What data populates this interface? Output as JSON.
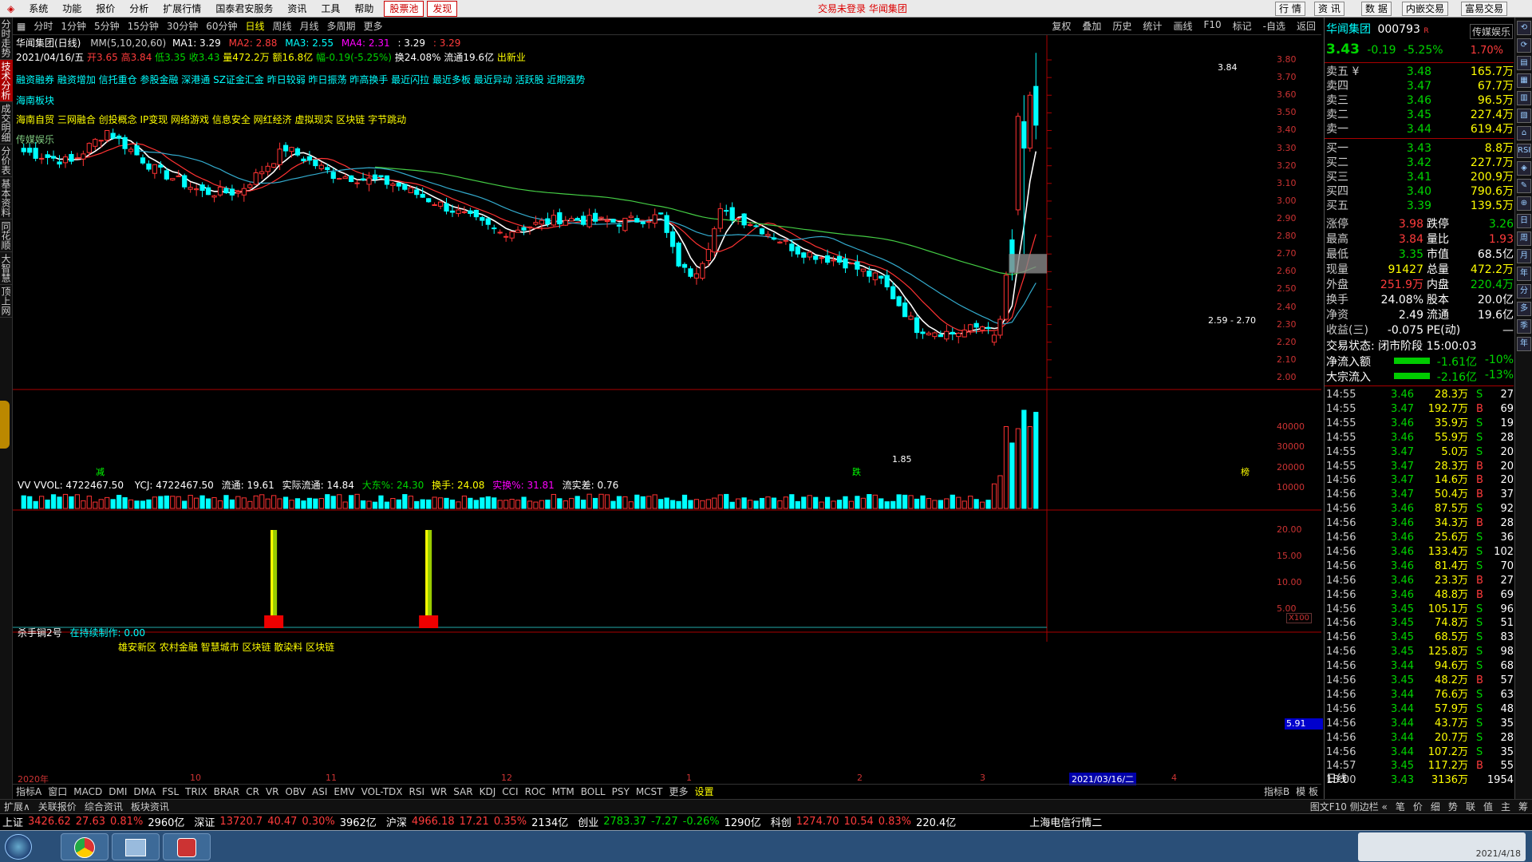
{
  "menubar": {
    "items": [
      "系统",
      "功能",
      "报价",
      "分析",
      "扩展行情",
      "国泰君安服务",
      "资讯",
      "工具",
      "帮助"
    ],
    "hot1": "股票池",
    "hot2": "发现",
    "center_text": "交易未登录  华闻集团",
    "right_buttons": [
      "行 情",
      "资 讯",
      "数 据",
      "内嵌交易",
      "富易交易"
    ]
  },
  "leftbar": [
    "分时走势",
    "技术分析",
    "成交明细",
    "分价表",
    "基本资料",
    "同花顺",
    "大智慧",
    "顶上网"
  ],
  "periodbar": {
    "periods": [
      "分时",
      "1分钟",
      "5分钟",
      "15分钟",
      "30分钟",
      "60分钟",
      "日线",
      "周线",
      "月线",
      "多周期",
      "更多"
    ],
    "active": "日线",
    "right": [
      "复权",
      "叠加",
      "历史",
      "统计",
      "画线",
      "F10",
      "标记",
      "-自选",
      "返回"
    ]
  },
  "chartinfo": {
    "title": "华闻集团(日线)",
    "ma_label": "MM(5,10,20,60)",
    "ma1": "MA1: 3.29",
    "ma2": "MA2: 2.88",
    "ma3": "MA3: 2.55",
    "ma4": "MA4: 2.31",
    "ma5": ": 3.29",
    "ma6": ": 3.29",
    "date": "2021/04/16/五",
    "open": "开3.65",
    "high": "高3.84",
    "low": "低3.35",
    "close": "收3.43",
    "vol": "量472.2万",
    "amount": "额16.8亿",
    "change": "幅-0.19(-5.25%)",
    "turnover": "换24.08%",
    "float": "流通19.6亿",
    "note": "出新业"
  },
  "tags": {
    "line1": "融资融券 融资增加 信托重仓 参股金融 深港通 SZ证金汇金 昨日较弱 昨日振荡 昨高换手 最近闪拉 最近多板 最近异动 活跃股 近期强势",
    "line2": "海南板块",
    "line3": "海南自贸 三网融合 创投概念 IP变现 网络游戏 信息安全 网红经济 虚拟现实 区块链 字节跳动",
    "line4": "传媒娱乐"
  },
  "chart_annotations": {
    "high_label": "3.84",
    "low_label": "1.85",
    "box_label": "2.59 - 2.70",
    "marker_1": "减",
    "marker_2": "跌",
    "marker_3": "榜"
  },
  "price_axis": [
    "3.80",
    "3.70",
    "3.60",
    "3.50",
    "3.40",
    "3.30",
    "3.20",
    "3.10",
    "3.00",
    "2.90",
    "2.80",
    "2.70",
    "2.60",
    "2.50",
    "2.40",
    "2.30",
    "2.20",
    "2.10",
    "2.00"
  ],
  "volume_panel": {
    "header": "VV VVOL: 4722467.50",
    "ycj": "YCJ: 4722467.50",
    "liutong": "流通: 19.61",
    "shiji": "实际流通: 14.84",
    "dadong": "大东%: 24.30",
    "huanshou": "换手: 24.08",
    "shihuan": "实换%: 31.81",
    "liushi": "流实差: 0.76",
    "axis": [
      "40000",
      "30000",
      "20000",
      "10000"
    ],
    "unit": "X100"
  },
  "indicator_panel": {
    "name": "杀手锏2号",
    "status": "在持续制作: 0.00",
    "sectors": "雄安新区 农村金融 智慧城市 区块链 散染料 区块链",
    "axis": [
      "20.00",
      "15.00",
      "10.00",
      "5.00"
    ],
    "current": "5.91"
  },
  "time_axis": [
    "2020年",
    "10",
    "11",
    "12",
    "1",
    "2",
    "3",
    "4"
  ],
  "time_highlight": "2021/03/16/二",
  "indicator_tabs": [
    "指标A",
    "窗口",
    "MACD",
    "DMI",
    "DMA",
    "FSL",
    "TRIX",
    "BRAR",
    "CR",
    "VR",
    "OBV",
    "ASI",
    "EMV",
    "VOL-TDX",
    "RSI",
    "WR",
    "SAR",
    "KDJ",
    "CCI",
    "ROC",
    "MTM",
    "BOLL",
    "PSY",
    "MCST",
    "更多",
    "设置"
  ],
  "indicator_tabs_right": [
    "指标B",
    "模 板"
  ],
  "right_panel": {
    "name": "华闻集团",
    "code": "000793",
    "badge": "R",
    "sector": "传媒娱乐",
    "price": "3.43",
    "change": "-0.19",
    "pct": "-5.25%",
    "weibi": "1.70%",
    "asks": [
      {
        "label": "卖五 ¥",
        "price": "3.48",
        "vol": "165.7万"
      },
      {
        "label": "卖四",
        "price": "3.47",
        "vol": "67.7万"
      },
      {
        "label": "卖三",
        "price": "3.46",
        "vol": "96.5万"
      },
      {
        "label": "卖二",
        "price": "3.45",
        "vol": "227.4万"
      },
      {
        "label": "卖一",
        "price": "3.44",
        "vol": "619.4万"
      }
    ],
    "bids": [
      {
        "label": "买一",
        "price": "3.43",
        "vol": "8.8万"
      },
      {
        "label": "买二",
        "price": "3.42",
        "vol": "227.7万"
      },
      {
        "label": "买三",
        "price": "3.41",
        "vol": "200.9万"
      },
      {
        "label": "买四",
        "price": "3.40",
        "vol": "790.6万"
      },
      {
        "label": "买五",
        "price": "3.39",
        "vol": "139.5万"
      }
    ],
    "stats": [
      {
        "l1": "涨停",
        "v1": "3.98",
        "l2": "跌停",
        "v2": "3.26"
      },
      {
        "l1": "最高",
        "v1": "3.84",
        "l2": "量比",
        "v2": "1.93"
      },
      {
        "l1": "最低",
        "v1": "3.35",
        "l2": "市值",
        "v2": "68.5亿"
      },
      {
        "l1": "现量",
        "v1": "91427",
        "l2": "总量",
        "v2": "472.2万"
      },
      {
        "l1": "外盘",
        "v1": "251.9万",
        "l2": "内盘",
        "v2": "220.4万"
      },
      {
        "l1": "换手",
        "v1": "24.08%",
        "l2": "股本",
        "v2": "20.0亿"
      },
      {
        "l1": "净资",
        "v1": "2.49",
        "l2": "流通",
        "v2": "19.6亿"
      },
      {
        "l1": "收益(三)",
        "v1": "-0.075",
        "l2": "PE(动)",
        "v2": "—"
      }
    ],
    "trade_status": "交易状态: 闭市阶段 15:00:03",
    "netflow": {
      "label": "净流入额",
      "value": "-1.61亿",
      "pct": "-10%"
    },
    "bigflow": {
      "label": "大宗流入",
      "value": "-2.16亿",
      "pct": "-13%"
    },
    "ticks": [
      {
        "t": "14:55",
        "p": "3.46",
        "v": "28.3万",
        "d": "S",
        "n": "27"
      },
      {
        "t": "14:55",
        "p": "3.47",
        "v": "192.7万",
        "d": "B",
        "n": "69"
      },
      {
        "t": "14:55",
        "p": "3.46",
        "v": "35.9万",
        "d": "S",
        "n": "19"
      },
      {
        "t": "14:55",
        "p": "3.46",
        "v": "55.9万",
        "d": "S",
        "n": "28"
      },
      {
        "t": "14:55",
        "p": "3.47",
        "v": "5.0万",
        "d": "S",
        "n": "20"
      },
      {
        "t": "14:55",
        "p": "3.47",
        "v": "28.3万",
        "d": "B",
        "n": "20"
      },
      {
        "t": "14:56",
        "p": "3.47",
        "v": "14.6万",
        "d": "B",
        "n": "20"
      },
      {
        "t": "14:56",
        "p": "3.47",
        "v": "50.4万",
        "d": "B",
        "n": "37"
      },
      {
        "t": "14:56",
        "p": "3.46",
        "v": "87.5万",
        "d": "S",
        "n": "92"
      },
      {
        "t": "14:56",
        "p": "3.46",
        "v": "34.3万",
        "d": "B",
        "n": "28"
      },
      {
        "t": "14:56",
        "p": "3.46",
        "v": "25.6万",
        "d": "S",
        "n": "36"
      },
      {
        "t": "14:56",
        "p": "3.46",
        "v": "133.4万",
        "d": "S",
        "n": "102"
      },
      {
        "t": "14:56",
        "p": "3.46",
        "v": "81.4万",
        "d": "S",
        "n": "70"
      },
      {
        "t": "14:56",
        "p": "3.46",
        "v": "23.3万",
        "d": "B",
        "n": "27"
      },
      {
        "t": "14:56",
        "p": "3.46",
        "v": "48.8万",
        "d": "B",
        "n": "69"
      },
      {
        "t": "14:56",
        "p": "3.45",
        "v": "105.1万",
        "d": "S",
        "n": "96"
      },
      {
        "t": "14:56",
        "p": "3.45",
        "v": "74.8万",
        "d": "S",
        "n": "51"
      },
      {
        "t": "14:56",
        "p": "3.45",
        "v": "68.5万",
        "d": "S",
        "n": "83"
      },
      {
        "t": "14:56",
        "p": "3.45",
        "v": "125.8万",
        "d": "S",
        "n": "98"
      },
      {
        "t": "14:56",
        "p": "3.44",
        "v": "94.6万",
        "d": "S",
        "n": "68"
      },
      {
        "t": "14:56",
        "p": "3.45",
        "v": "48.2万",
        "d": "B",
        "n": "57"
      },
      {
        "t": "14:56",
        "p": "3.44",
        "v": "76.6万",
        "d": "S",
        "n": "63"
      },
      {
        "t": "14:56",
        "p": "3.44",
        "v": "57.9万",
        "d": "S",
        "n": "48"
      },
      {
        "t": "14:56",
        "p": "3.44",
        "v": "43.7万",
        "d": "S",
        "n": "35"
      },
      {
        "t": "14:56",
        "p": "3.44",
        "v": "20.7万",
        "d": "S",
        "n": "28"
      },
      {
        "t": "14:56",
        "p": "3.44",
        "v": "107.2万",
        "d": "S",
        "n": "35"
      },
      {
        "t": "14:57",
        "p": "3.45",
        "v": "117.2万",
        "d": "B",
        "n": "55"
      },
      {
        "t": "15:00",
        "p": "3.43",
        "v": "3136万",
        "d": "",
        "n": "1954"
      }
    ],
    "bottom_label": "日线"
  },
  "rightsidebar": [
    "⟲",
    "⟳",
    "▤",
    "▦",
    "▥",
    "▧",
    "⌂",
    "RSI",
    "◈",
    "✎",
    "⊕",
    "日",
    "周",
    "月",
    "年",
    "分",
    "多",
    "季",
    "年"
  ],
  "bottomtabs": [
    "扩展∧",
    "关联报价",
    "综合资讯",
    "板块资讯"
  ],
  "bottomtabs_right": [
    "图文F10 侧边栏 «",
    "笔",
    "价",
    "细",
    "势",
    "联",
    "值",
    "主",
    "筹"
  ],
  "indexbar": [
    {
      "name": "上证",
      "v": "3426.62",
      "c": "27.63",
      "p": "0.81%",
      "a": "2960亿"
    },
    {
      "name": "深证",
      "v": "13720.7",
      "c": "40.47",
      "p": "0.30%",
      "a": "3962亿"
    },
    {
      "name": "沪深",
      "v": "4966.18",
      "c": "17.21",
      "p": "0.35%",
      "a": "2134亿"
    },
    {
      "name": "创业",
      "v": "2783.37",
      "c": "-7.27",
      "p": "-0.26%",
      "a": "1290亿"
    },
    {
      "name": "科创",
      "v": "1274.70",
      "c": "10.54",
      "p": "0.83%",
      "a": "220.4亿"
    }
  ],
  "indexbar_tail": "上海电信行情二",
  "taskbar": {
    "clock": "2021/4/18"
  },
  "chart_data": {
    "type": "candlestick",
    "price_range": [
      1.85,
      3.84
    ],
    "recent_bars": [
      {
        "o": 2.2,
        "h": 2.26,
        "l": 2.18,
        "c": 2.24
      },
      {
        "o": 2.24,
        "h": 2.35,
        "l": 2.22,
        "c": 2.33
      },
      {
        "o": 2.33,
        "h": 2.6,
        "l": 2.32,
        "c": 2.58
      },
      {
        "o": 2.78,
        "h": 2.84,
        "l": 2.55,
        "c": 2.6
      },
      {
        "o": 2.95,
        "h": 3.5,
        "l": 2.92,
        "c": 3.48
      },
      {
        "o": 3.45,
        "h": 3.6,
        "l": 2.7,
        "c": 3.3
      },
      {
        "o": 3.3,
        "h": 3.62,
        "l": 3.28,
        "c": 3.6
      },
      {
        "o": 3.65,
        "h": 3.84,
        "l": 3.35,
        "c": 3.43
      }
    ]
  }
}
